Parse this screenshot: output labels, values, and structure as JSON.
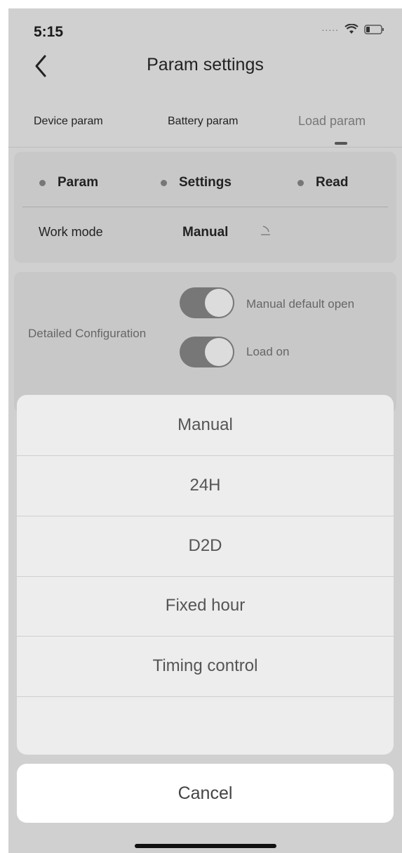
{
  "status_bar": {
    "time": "5:15",
    "dots": "....."
  },
  "nav": {
    "title": "Param settings"
  },
  "tabs": [
    {
      "label": "Device param"
    },
    {
      "label": "Battery param"
    },
    {
      "label": "Load param"
    }
  ],
  "legend": [
    {
      "label": "Param"
    },
    {
      "label": "Settings"
    },
    {
      "label": "Read"
    }
  ],
  "work_mode": {
    "label": "Work mode",
    "value": "Manual"
  },
  "detailed_config": {
    "label": "Detailed Configuration",
    "toggles": [
      {
        "label": "Manual default open",
        "on": true
      },
      {
        "label": "Load on",
        "on": true
      }
    ]
  },
  "action_sheet": {
    "options": [
      "Manual",
      "24H",
      "D2D",
      "Fixed hour",
      "Timing control"
    ],
    "cancel": "Cancel"
  }
}
